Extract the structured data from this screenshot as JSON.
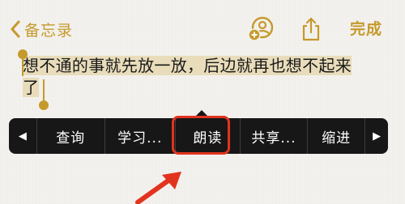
{
  "nav": {
    "back_label": "备忘录",
    "done_label": "完成",
    "accent_color": "#c59a2c",
    "icons": [
      "chevron-left-icon",
      "add-person-icon",
      "share-icon"
    ]
  },
  "note": {
    "text_line1": "想不通的事就先放一放，后边就再也想不起来",
    "text_line2": "了"
  },
  "context_menu": {
    "left_arrow": "◀",
    "right_arrow": "▶",
    "items": [
      {
        "label": "查询"
      },
      {
        "label": "学习..."
      },
      {
        "label": "朗读"
      },
      {
        "label": "共享..."
      },
      {
        "label": "缩进"
      }
    ]
  },
  "annotation": {
    "highlight_color": "#e2331f"
  }
}
